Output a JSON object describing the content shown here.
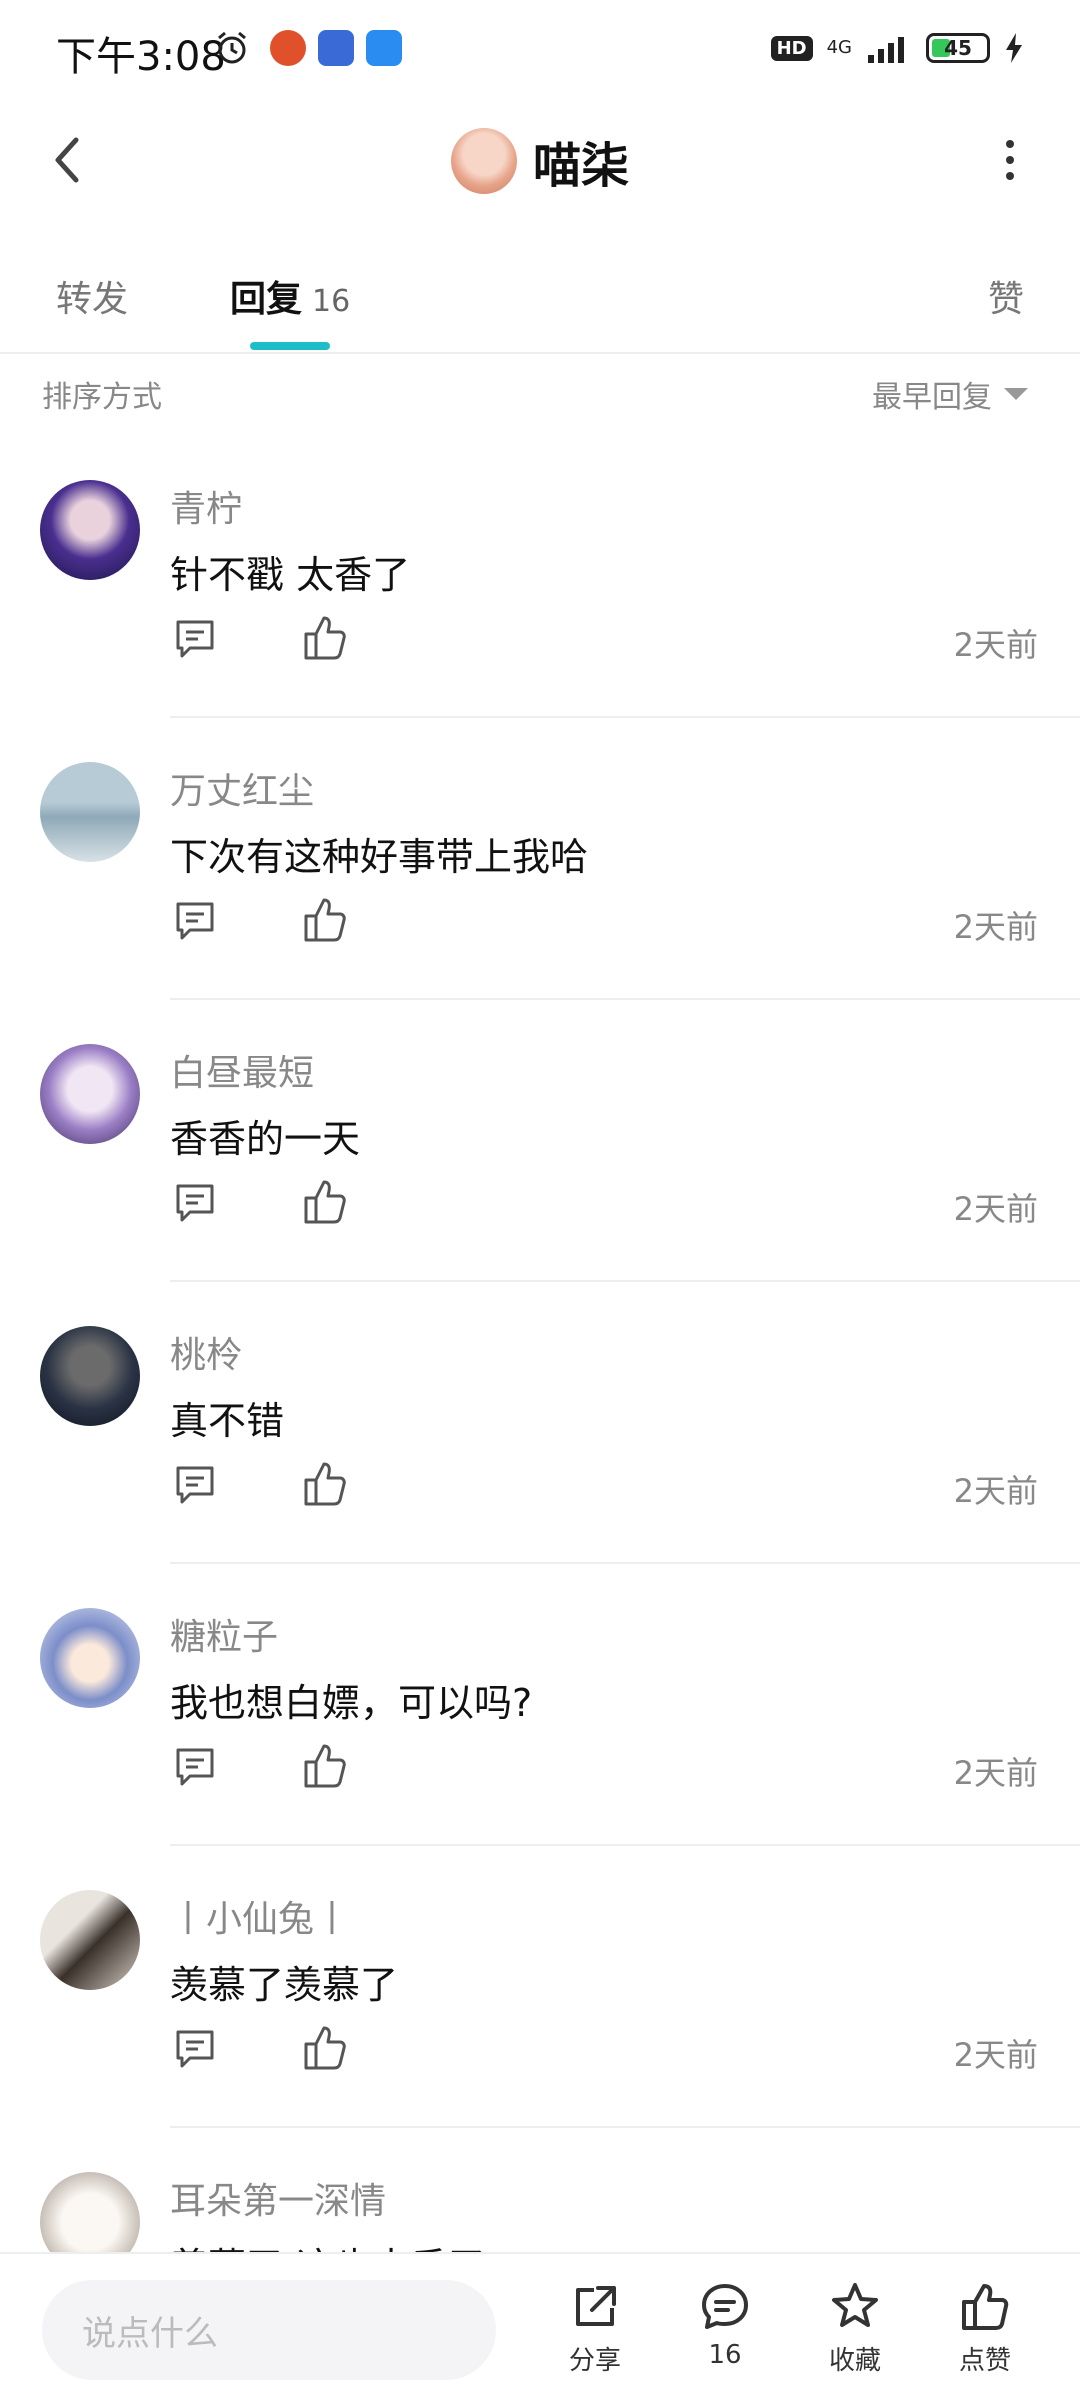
{
  "status_bar": {
    "time": "下午3:08",
    "hd": "HD",
    "network": "4G",
    "battery": "45"
  },
  "header": {
    "title": "喵柒"
  },
  "tabs": {
    "repost": "转发",
    "reply": "回复",
    "reply_count": "16",
    "like": "赞"
  },
  "sort": {
    "label": "排序方式",
    "value": "最早回复"
  },
  "comments": [
    {
      "name": "青柠",
      "text": "针不戳  太香了",
      "time": "2天前"
    },
    {
      "name": "万丈红尘",
      "text": "下次有这种好事带上我哈",
      "time": "2天前"
    },
    {
      "name": "白昼最短",
      "text": "香香的一天",
      "time": "2天前"
    },
    {
      "name": "桃柃",
      "text": "真不错",
      "time": "2天前"
    },
    {
      "name": "糖粒子",
      "text": "我也想白嫖，可以吗?",
      "time": "2天前"
    },
    {
      "name": "丨小仙兔丨",
      "text": "羡慕了羡慕了",
      "time": "2天前"
    },
    {
      "name": "耳朵第一深情",
      "text": "羡慕了 这也太香了",
      "time": ""
    }
  ],
  "bottom": {
    "placeholder": "说点什么",
    "share": "分享",
    "comments": "16",
    "favorite": "收藏",
    "like": "点赞"
  },
  "colors": {
    "accent": "#1ebec8"
  }
}
